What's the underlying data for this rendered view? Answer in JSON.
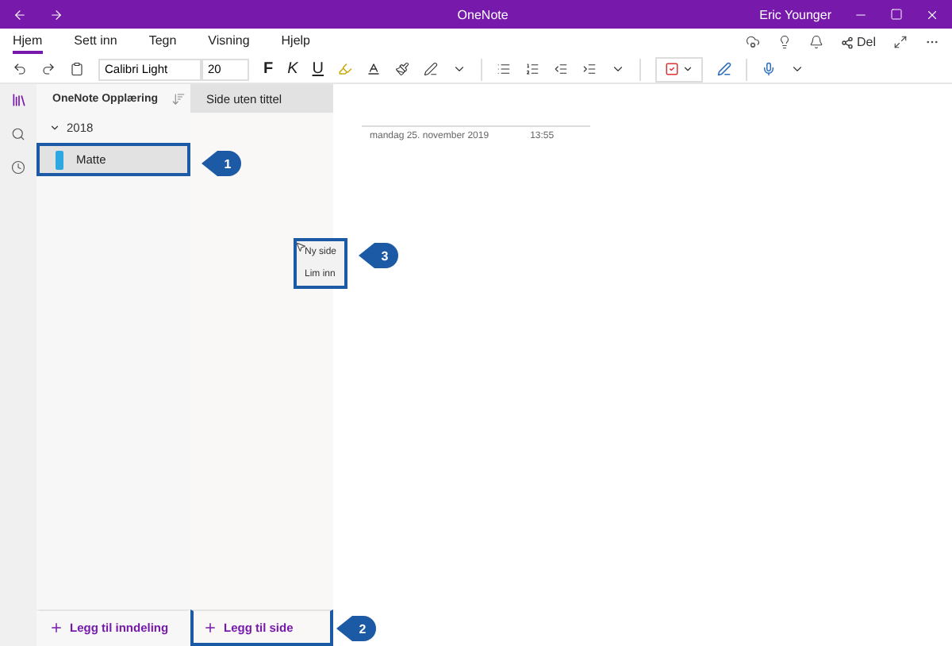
{
  "window": {
    "title": "OneNote",
    "user": "Eric Younger"
  },
  "menu_tabs": [
    {
      "label": "Hjem",
      "selected": true
    },
    {
      "label": "Sett inn",
      "selected": false
    },
    {
      "label": "Tegn",
      "selected": false
    },
    {
      "label": "Visning",
      "selected": false
    },
    {
      "label": "Hjelp",
      "selected": false
    }
  ],
  "share_button": "Del",
  "toolbar": {
    "font": "Calibri Light",
    "size": "20",
    "format_buttons": [
      "F",
      "K",
      "U"
    ]
  },
  "notebook": {
    "name": "OneNote Opplæring"
  },
  "section_groups": [
    {
      "name": "2018",
      "expanded": true,
      "sections": [
        {
          "name": "Matte",
          "selected": true,
          "color": "#2ea8e0",
          "outlined": true
        }
      ]
    }
  ],
  "pages": [
    {
      "title": "Side uten tittel",
      "selected": true
    }
  ],
  "page": {
    "date": "mandag 25. november 2019",
    "time": "13:55"
  },
  "context_menu": {
    "outlined": true,
    "items": [
      "Ny side",
      "Lim inn"
    ]
  },
  "add_section": "Legg til inndeling",
  "add_page": {
    "label": "Legg til side",
    "outlined": true
  },
  "callouts": [
    "1",
    "2",
    "3"
  ]
}
